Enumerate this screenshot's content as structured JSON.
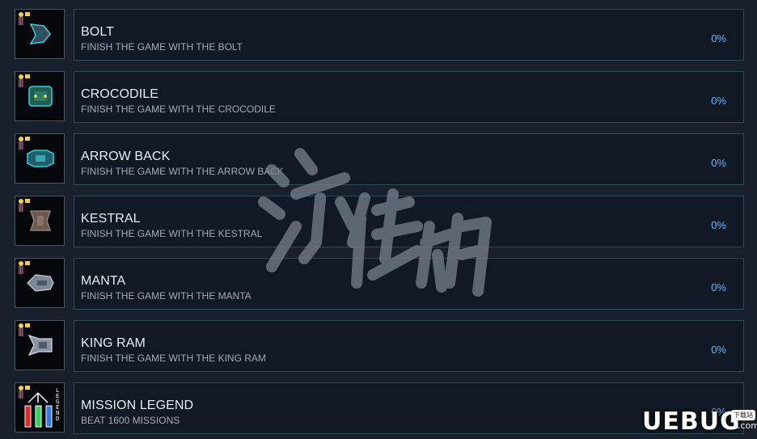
{
  "achievements": [
    {
      "title": "BOLT",
      "desc": "FINISH THE GAME WITH THE BOLT",
      "percent": "0%",
      "icon": "bolt-ship-icon"
    },
    {
      "title": "CROCODILE",
      "desc": "FINISH THE GAME WITH THE CROCODILE",
      "percent": "0%",
      "icon": "crocodile-ship-icon"
    },
    {
      "title": "ARROW BACK",
      "desc": "FINISH THE GAME WITH THE ARROW BACK",
      "percent": "0%",
      "icon": "arrow-back-ship-icon"
    },
    {
      "title": "KESTRAL",
      "desc": "FINISH THE GAME WITH THE KESTRAL",
      "percent": "0%",
      "icon": "kestral-ship-icon"
    },
    {
      "title": "MANTA",
      "desc": "FINISH THE GAME WITH THE MANTA",
      "percent": "0%",
      "icon": "manta-ship-icon"
    },
    {
      "title": "KING RAM",
      "desc": "FINISH THE GAME WITH THE KING RAM",
      "percent": "0%",
      "icon": "king-ram-ship-icon"
    },
    {
      "title": "MISSION LEGEND",
      "desc": "BEAT 1600 MISSIONS",
      "percent": "0%",
      "icon": "legend-bars-icon",
      "icon_text": "LEGEND"
    }
  ],
  "watermark": {
    "text": "游侠网"
  },
  "brand": {
    "name": "UEBUG",
    "tag": "下载站",
    "suffix": ".com"
  },
  "colors": {
    "background": "#18202b",
    "panel": "#111a24",
    "panel_border": "#2f4a5c",
    "title": "#e6edf3",
    "desc": "#a1acb8",
    "percent": "#62b6ff"
  }
}
